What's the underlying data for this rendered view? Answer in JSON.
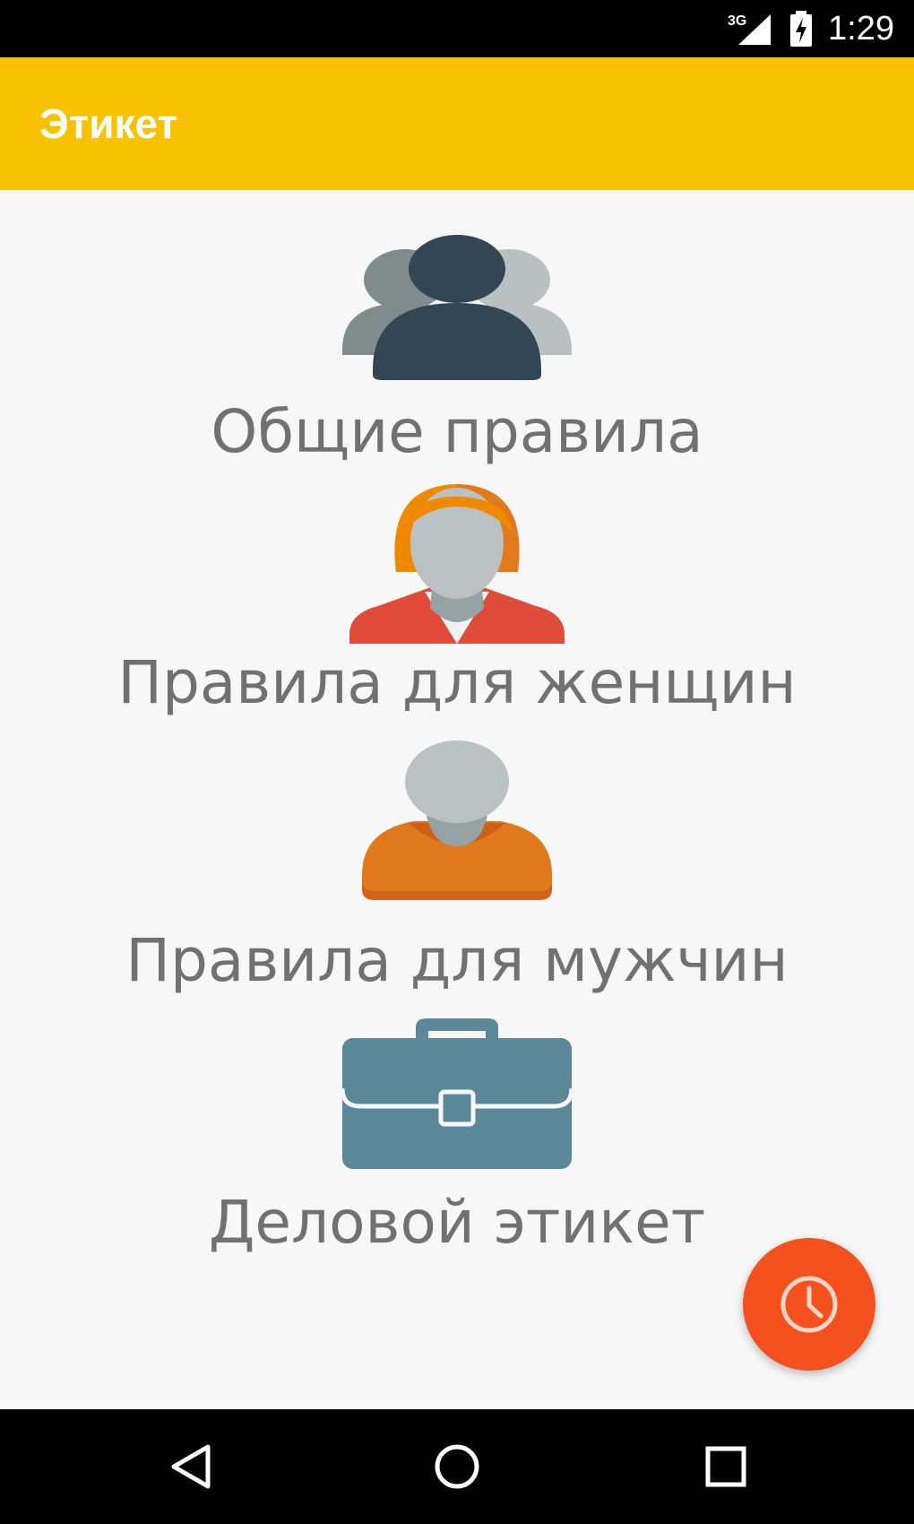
{
  "status_bar": {
    "network_label": "3G",
    "time": "1:29"
  },
  "app_bar": {
    "title": "Этикет"
  },
  "menu": {
    "items": [
      {
        "label": "Общие правила",
        "icon": "people-group-icon"
      },
      {
        "label": "Правила для женщин",
        "icon": "woman-icon"
      },
      {
        "label": "Правила для мужчин",
        "icon": "man-icon"
      },
      {
        "label": "Деловой этикет",
        "icon": "briefcase-icon"
      }
    ]
  },
  "fab": {
    "icon": "clock-icon"
  },
  "nav_bar": {
    "buttons": [
      "back-icon",
      "home-icon",
      "recents-icon"
    ]
  },
  "colors": {
    "app_bar": "#f9c200",
    "background": "#f7f7f8",
    "label_text": "#717171",
    "fab": "#f4511e",
    "group_front": "#334656",
    "group_back_left": "#7f8b8c",
    "group_back_right": "#b9c0c1",
    "woman_hair": "#ef8a00",
    "woman_top": "#e14b3a",
    "man_shirt": "#e0781e",
    "briefcase": "#5a8899"
  }
}
